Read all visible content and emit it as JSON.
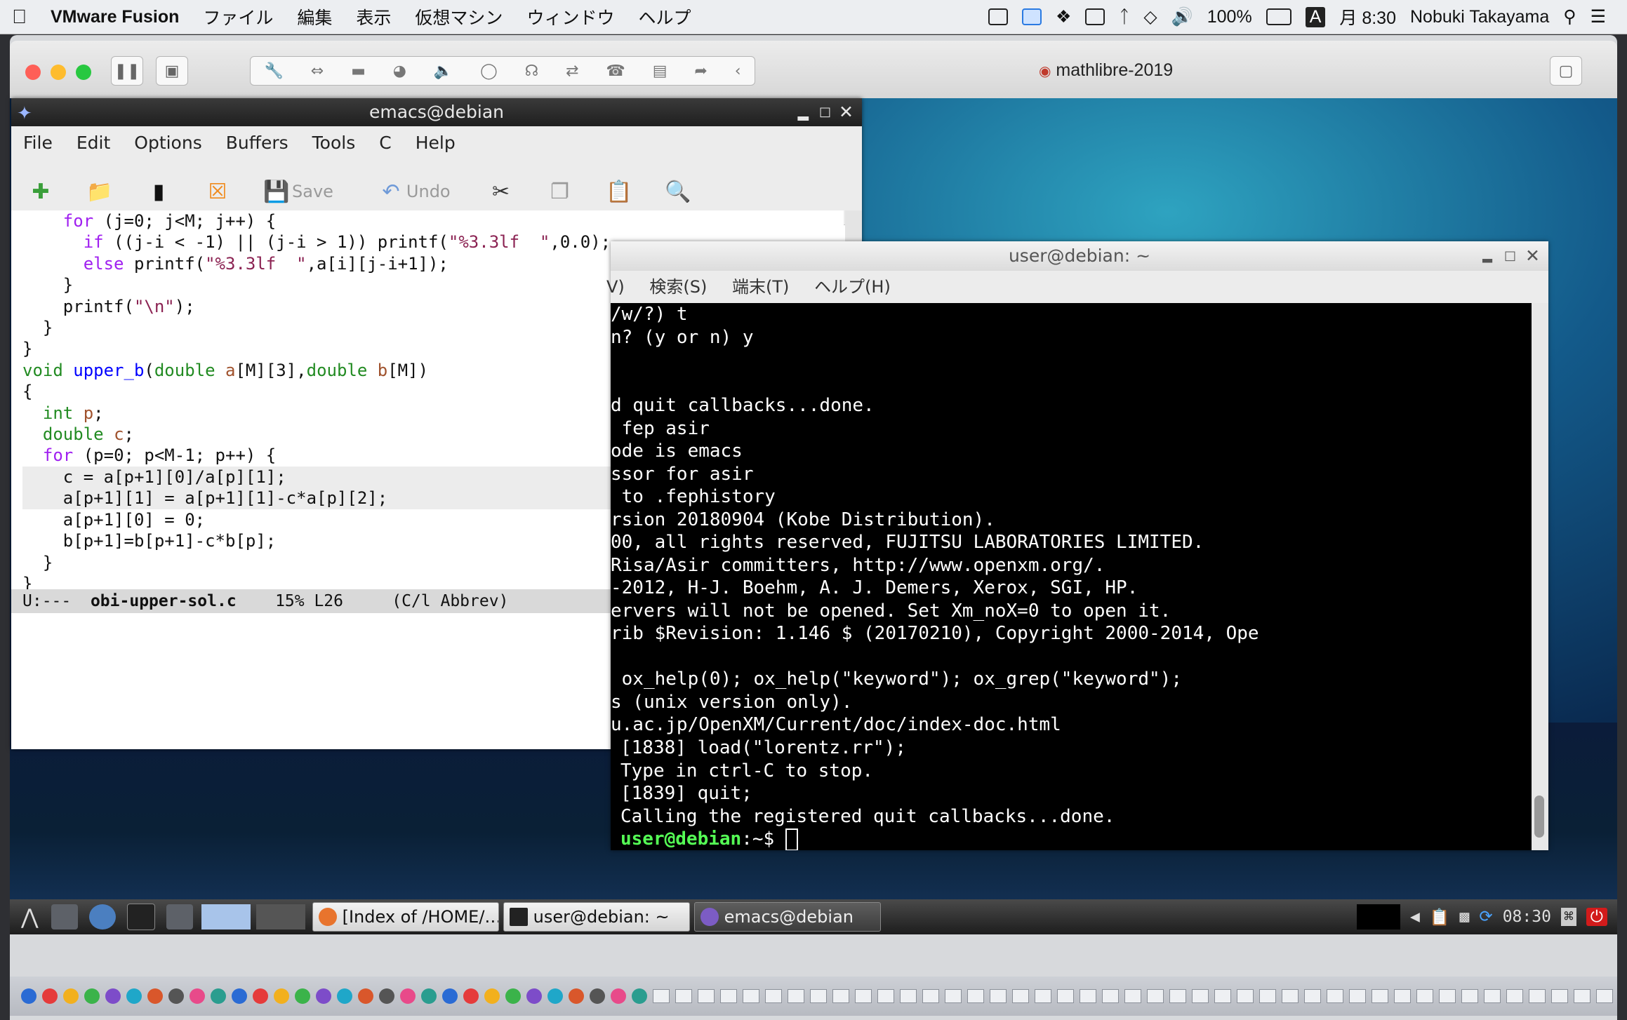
{
  "mac_menubar": {
    "app": "VMware Fusion",
    "menus": [
      "ファイル",
      "編集",
      "表示",
      "仮想マシン",
      "ウィンドウ",
      "ヘルプ"
    ],
    "battery": "100%",
    "input_indicator": "A",
    "clock": "月 8:30",
    "user": "Nobuki Takayama"
  },
  "fusion": {
    "vm_title": "mathlibre-2019"
  },
  "emacs": {
    "title": "emacs@debian",
    "menus": [
      "File",
      "Edit",
      "Options",
      "Buffers",
      "Tools",
      "C",
      "Help"
    ],
    "toolbar": {
      "save_label": "Save",
      "undo_label": "Undo"
    },
    "modeline": {
      "status": "U:---",
      "buffer": "obi-upper-sol.c",
      "position": "15% L26",
      "mode": "(C/l Abbrev)"
    }
  },
  "terminal": {
    "title": "user@debian: ~",
    "menus": [
      "V)",
      "検索(S)",
      "端末(T)",
      "ヘルプ(H)"
    ],
    "lines": [
      "/w/?) t",
      "n? (y or n) y",
      "",
      "",
      "d quit callbacks...done.",
      " fep asir",
      "ode is emacs",
      "ssor for asir",
      " to .fephistory",
      "rsion 20180904 (Kobe Distribution).",
      "00, all rights reserved, FUJITSU LABORATORIES LIMITED.",
      "Risa/Asir committers, http://www.openxm.org/.",
      "-2012, H-J. Boehm, A. J. Demers, Xerox, SGI, HP.",
      "ervers will not be opened. Set Xm_noX=0 to open it.",
      "rib $Revision: 1.146 $ (20170210), Copyright 2000-2014, Ope",
      "",
      " ox_help(0); ox_help(\"keyword\"); ox_grep(\"keyword\");",
      "s (unix version only).",
      "u.ac.jp/OpenXM/Current/doc/index-doc.html",
      "[1838] load(\"lorentz.rr\");",
      "Type in ctrl-C to stop.",
      "[1839] quit;",
      "Calling the registered quit callbacks...done."
    ],
    "prompt_user": "user@debian",
    "prompt_rest": ":~$ "
  },
  "taskbar": {
    "tasks": [
      "[Index of /HOME/…",
      "user@debian: ~",
      "emacs@debian"
    ],
    "clock": "08:30"
  },
  "colors": {
    "emacs_keyword": "#a020f0",
    "emacs_type": "#228b22",
    "emacs_function": "#0000ff",
    "emacs_variable": "#a0522d",
    "emacs_string": "#8b2252",
    "terminal_prompt": "#55ff55"
  }
}
